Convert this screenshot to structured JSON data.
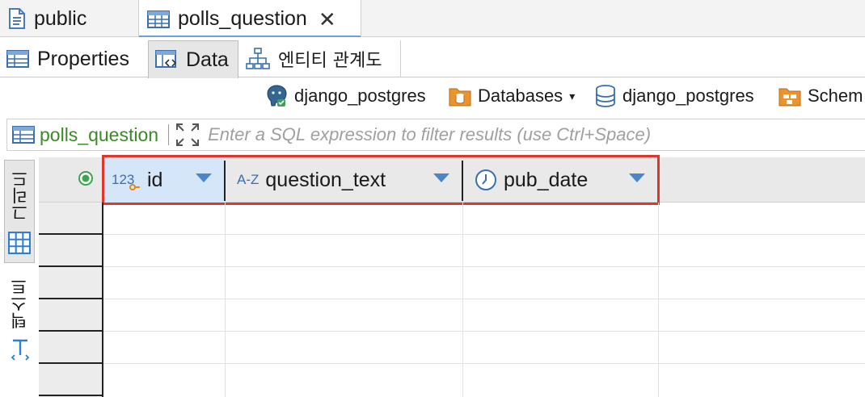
{
  "editor_tabs": [
    {
      "label": "public",
      "icon": "document-icon"
    },
    {
      "label": "polls_question",
      "icon": "table-icon",
      "active": true,
      "close": "✕"
    }
  ],
  "sub_tabs": [
    {
      "label": "Properties",
      "icon": "table-icon"
    },
    {
      "label": "Data",
      "icon": "data-grid-icon",
      "active": true
    },
    {
      "label": "엔티티 관계도",
      "icon": "er-diagram-icon"
    }
  ],
  "breadcrumb": [
    {
      "label": "django_postgres",
      "icon": "postgres-elephant-icon"
    },
    {
      "label": "Databases",
      "icon": "databases-folder-icon",
      "dropdown": "▾"
    },
    {
      "label": "django_postgres",
      "icon": "database-icon"
    },
    {
      "label": "Schem",
      "icon": "schemas-folder-icon"
    }
  ],
  "filter": {
    "table_name": "polls_question",
    "placeholder": "Enter a SQL expression to filter results (use Ctrl+Space)"
  },
  "side_tabs": [
    {
      "label": "그리드",
      "icon": "grid-icon",
      "active": true
    },
    {
      "label": "텍스트",
      "icon": "text-icon"
    }
  ],
  "columns": [
    {
      "name": "id",
      "type_icon": "numeric-key-icon",
      "type_label": "123"
    },
    {
      "name": "question_text",
      "type_icon": "text-type-icon",
      "type_label": "A-Z"
    },
    {
      "name": "pub_date",
      "type_icon": "clock-icon"
    }
  ],
  "colors": {
    "highlight_border": "#e0352a",
    "filter_table_text": "#3b8a26",
    "sort_arrow": "#4a86c8",
    "selected_column_bg": "#d5e6f8"
  }
}
